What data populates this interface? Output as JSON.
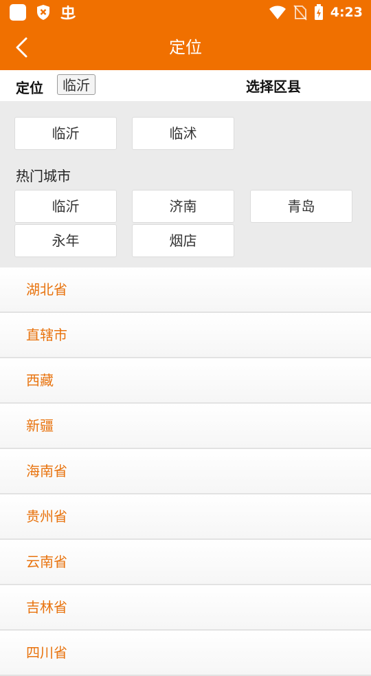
{
  "status_bar": {
    "time": "4:23",
    "left_icons": [
      "app-square-icon",
      "shield-x-icon",
      "bug-icon"
    ],
    "right_icons": [
      "wifi-icon",
      "no-sim-icon",
      "battery-charging-icon"
    ]
  },
  "header": {
    "title": "定位",
    "back_icon": "chevron-left-icon",
    "background": "#f07000"
  },
  "location_bar": {
    "label": "定位",
    "current_city": "临沂",
    "select_district": "选择区县"
  },
  "districts": [
    "临沂",
    "临沭"
  ],
  "hot_cities": {
    "label": "热门城市",
    "items": [
      "临沂",
      "济南",
      "青岛",
      "永年",
      "烟店"
    ]
  },
  "provinces": [
    "湖北省",
    "直辖市",
    "西藏",
    "新疆",
    "海南省",
    "贵州省",
    "云南省",
    "吉林省",
    "四川省"
  ],
  "colors": {
    "accent": "#f07000",
    "province_text": "#e8730e",
    "grid_background": "#ebebeb"
  }
}
